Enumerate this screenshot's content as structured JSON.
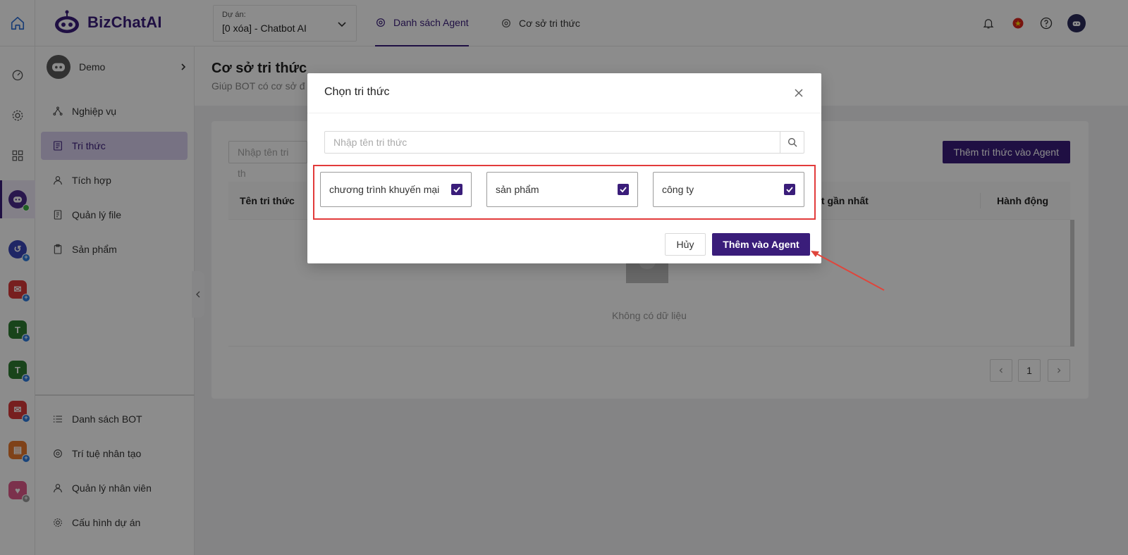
{
  "header": {
    "brand": "BizChatAI",
    "project_label": "Dự án:",
    "project_value": "[0 xóa] - Chatbot AI",
    "tabs": [
      {
        "label": "Danh sách Agent",
        "active": true
      },
      {
        "label": "Cơ sở tri thức",
        "active": false
      }
    ],
    "icons": [
      "bell-icon",
      "vietnam-flag-icon",
      "help-icon",
      "user-avatar"
    ]
  },
  "rail": {
    "icons": [
      "home-icon",
      "dashboard-icon",
      "settings-icon",
      "grid-icon",
      "chatbot-icon",
      "app-icon",
      "mail-icon",
      "app-icon",
      "app-icon",
      "mail-icon",
      "clipboard-icon",
      "heart-app-icon"
    ]
  },
  "sidebar": {
    "bot_name": "Demo",
    "items": [
      {
        "label": "Nghiệp vụ",
        "icon": "workflow-icon"
      },
      {
        "label": "Tri thức",
        "icon": "document-icon",
        "active": true
      },
      {
        "label": "Tích hợp",
        "icon": "user-icon"
      },
      {
        "label": "Quản lý file",
        "icon": "file-icon"
      },
      {
        "label": "Sản phẩm",
        "icon": "clipboard-icon"
      }
    ],
    "bottom_items": [
      {
        "label": "Danh sách BOT",
        "icon": "list-icon"
      },
      {
        "label": "Trí tuệ nhân tạo",
        "icon": "ai-icon"
      },
      {
        "label": "Quản lý nhân viên",
        "icon": "user-icon"
      },
      {
        "label": "Cấu hình dự án",
        "icon": "gear-icon"
      }
    ]
  },
  "main": {
    "title": "Cơ sở tri thức",
    "subtitle": "Giúp BOT có cơ sở đ",
    "search_placeholder": "Nhập tên tri th",
    "add_button": "Thêm tri thức vào Agent",
    "columns": [
      "Tên tri thức",
      "nhật gần nhất",
      "Hành động"
    ],
    "empty_text": "Không có dữ liệu",
    "page": "1"
  },
  "modal": {
    "title": "Chọn tri thức",
    "search_placeholder": "Nhập tên tri thức",
    "options": [
      {
        "label": "chương trình khuyến mại",
        "checked": true
      },
      {
        "label": "sản phẩm",
        "checked": true
      },
      {
        "label": "công ty",
        "checked": true
      }
    ],
    "cancel": "Hủy",
    "confirm": "Thêm vào Agent"
  },
  "colors": {
    "brand": "#3a1d7a",
    "highlight": "#e23b3b"
  }
}
